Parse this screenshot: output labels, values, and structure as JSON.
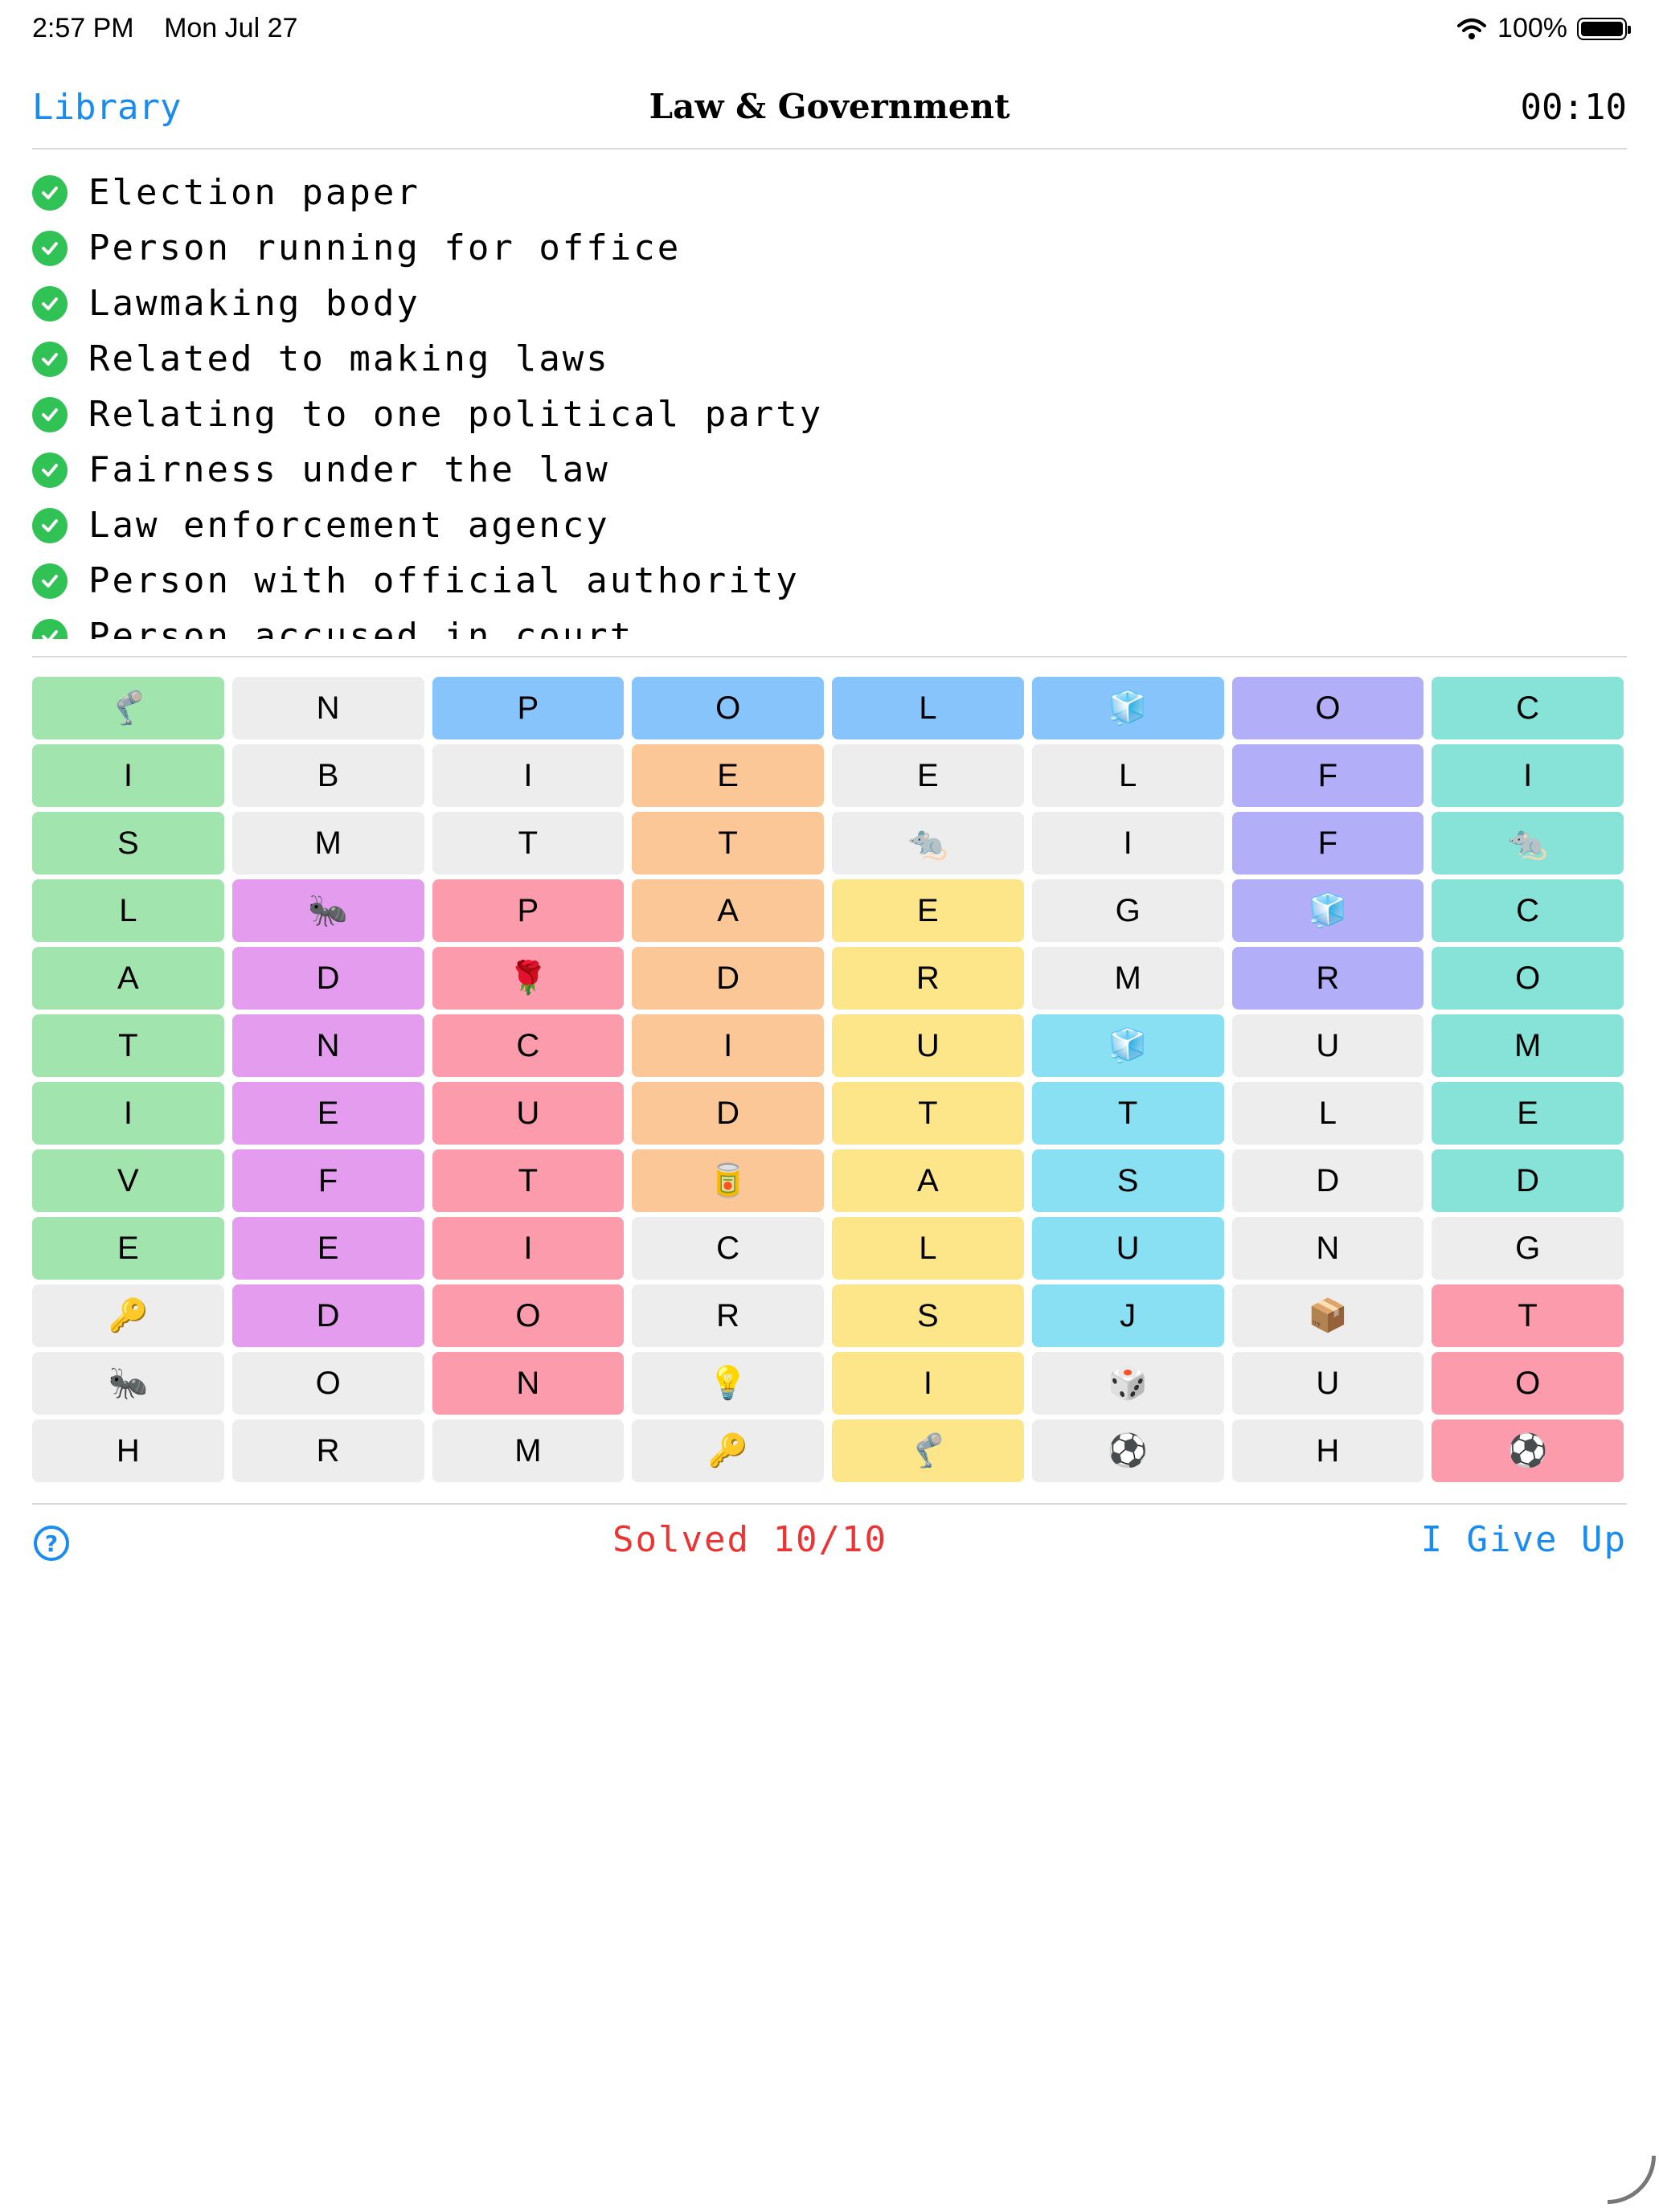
{
  "status_bar": {
    "time": "2:57 PM",
    "date": "Mon Jul 27",
    "battery": "100%"
  },
  "nav": {
    "back_label": "Library",
    "title": "Law & Government",
    "timer": "00:10"
  },
  "clues": [
    "Election paper",
    "Person running for office",
    "Lawmaking body",
    "Related to making laws",
    "Relating to one political party",
    "Fairness under the law",
    "Law enforcement agency",
    "Person with official authority",
    "Person accused in court"
  ],
  "colors": {
    "green": "#a2e4ad",
    "gray": "#ededed",
    "blue": "#87c4fb",
    "purple": "#b3aef8",
    "teal": "#87e3d8",
    "orange": "#fcc796",
    "yellow": "#fde68a",
    "pink": "#fb9bab",
    "magenta": "#e49cef",
    "cyan": "#89e0f3"
  },
  "grid": [
    [
      {
        "t": "🦿",
        "c": "green"
      },
      {
        "t": "N",
        "c": "gray"
      },
      {
        "t": "P",
        "c": "blue"
      },
      {
        "t": "O",
        "c": "blue"
      },
      {
        "t": "L",
        "c": "blue"
      },
      {
        "t": "🧊",
        "c": "blue"
      },
      {
        "t": "O",
        "c": "purple"
      },
      {
        "t": "C",
        "c": "teal"
      }
    ],
    [
      {
        "t": "I",
        "c": "green"
      },
      {
        "t": "B",
        "c": "gray"
      },
      {
        "t": "I",
        "c": "gray"
      },
      {
        "t": "E",
        "c": "orange"
      },
      {
        "t": "E",
        "c": "gray"
      },
      {
        "t": "L",
        "c": "gray"
      },
      {
        "t": "F",
        "c": "purple"
      },
      {
        "t": "I",
        "c": "teal"
      }
    ],
    [
      {
        "t": "S",
        "c": "green"
      },
      {
        "t": "M",
        "c": "gray"
      },
      {
        "t": "T",
        "c": "gray"
      },
      {
        "t": "T",
        "c": "orange"
      },
      {
        "t": "🐀",
        "c": "gray"
      },
      {
        "t": "I",
        "c": "gray"
      },
      {
        "t": "F",
        "c": "purple"
      },
      {
        "t": "🐀",
        "c": "teal"
      }
    ],
    [
      {
        "t": "L",
        "c": "green"
      },
      {
        "t": "🐜",
        "c": "magenta"
      },
      {
        "t": "P",
        "c": "pink"
      },
      {
        "t": "A",
        "c": "orange"
      },
      {
        "t": "E",
        "c": "yellow"
      },
      {
        "t": "G",
        "c": "gray"
      },
      {
        "t": "🧊",
        "c": "purple"
      },
      {
        "t": "C",
        "c": "teal"
      }
    ],
    [
      {
        "t": "A",
        "c": "green"
      },
      {
        "t": "D",
        "c": "magenta"
      },
      {
        "t": "🌹",
        "c": "pink"
      },
      {
        "t": "D",
        "c": "orange"
      },
      {
        "t": "R",
        "c": "yellow"
      },
      {
        "t": "M",
        "c": "gray"
      },
      {
        "t": "R",
        "c": "purple"
      },
      {
        "t": "O",
        "c": "teal"
      }
    ],
    [
      {
        "t": "T",
        "c": "green"
      },
      {
        "t": "N",
        "c": "magenta"
      },
      {
        "t": "C",
        "c": "pink"
      },
      {
        "t": "I",
        "c": "orange"
      },
      {
        "t": "U",
        "c": "yellow"
      },
      {
        "t": "🧊",
        "c": "cyan"
      },
      {
        "t": "U",
        "c": "gray"
      },
      {
        "t": "M",
        "c": "teal"
      }
    ],
    [
      {
        "t": "I",
        "c": "green"
      },
      {
        "t": "E",
        "c": "magenta"
      },
      {
        "t": "U",
        "c": "pink"
      },
      {
        "t": "D",
        "c": "orange"
      },
      {
        "t": "T",
        "c": "yellow"
      },
      {
        "t": "T",
        "c": "cyan"
      },
      {
        "t": "L",
        "c": "gray"
      },
      {
        "t": "E",
        "c": "teal"
      }
    ],
    [
      {
        "t": "V",
        "c": "green"
      },
      {
        "t": "F",
        "c": "magenta"
      },
      {
        "t": "T",
        "c": "pink"
      },
      {
        "t": "🥫",
        "c": "orange"
      },
      {
        "t": "A",
        "c": "yellow"
      },
      {
        "t": "S",
        "c": "cyan"
      },
      {
        "t": "D",
        "c": "gray"
      },
      {
        "t": "D",
        "c": "teal"
      }
    ],
    [
      {
        "t": "E",
        "c": "green"
      },
      {
        "t": "E",
        "c": "magenta"
      },
      {
        "t": "I",
        "c": "pink"
      },
      {
        "t": "C",
        "c": "gray"
      },
      {
        "t": "L",
        "c": "yellow"
      },
      {
        "t": "U",
        "c": "cyan"
      },
      {
        "t": "N",
        "c": "gray"
      },
      {
        "t": "G",
        "c": "gray"
      }
    ],
    [
      {
        "t": "🔑",
        "c": "gray"
      },
      {
        "t": "D",
        "c": "magenta"
      },
      {
        "t": "O",
        "c": "pink"
      },
      {
        "t": "R",
        "c": "gray"
      },
      {
        "t": "S",
        "c": "yellow"
      },
      {
        "t": "J",
        "c": "cyan"
      },
      {
        "t": "📦",
        "c": "gray"
      },
      {
        "t": "T",
        "c": "pink"
      }
    ],
    [
      {
        "t": "🐜",
        "c": "gray"
      },
      {
        "t": "O",
        "c": "gray"
      },
      {
        "t": "N",
        "c": "pink"
      },
      {
        "t": "💡",
        "c": "gray"
      },
      {
        "t": "I",
        "c": "yellow"
      },
      {
        "t": "🎲",
        "c": "gray"
      },
      {
        "t": "U",
        "c": "gray"
      },
      {
        "t": "O",
        "c": "pink"
      }
    ],
    [
      {
        "t": "H",
        "c": "gray"
      },
      {
        "t": "R",
        "c": "gray"
      },
      {
        "t": "M",
        "c": "gray"
      },
      {
        "t": "🔑",
        "c": "gray"
      },
      {
        "t": "🦿",
        "c": "yellow"
      },
      {
        "t": "⚽",
        "c": "gray"
      },
      {
        "t": "H",
        "c": "gray"
      },
      {
        "t": "⚽",
        "c": "pink"
      }
    ]
  ],
  "footer": {
    "help_icon": "?",
    "solved_text": "Solved 10/10",
    "give_up_label": "I Give Up"
  }
}
